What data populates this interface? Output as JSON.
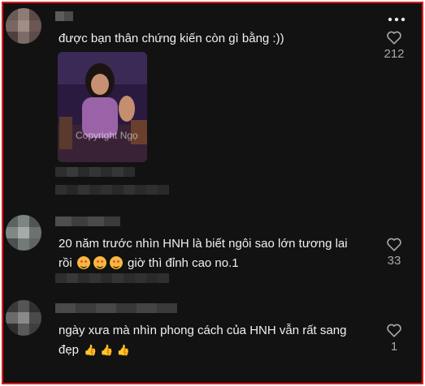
{
  "comments": [
    {
      "text": "được bạn thân chứng kiến còn gì bằng :))",
      "likes": "212",
      "photo_watermark": "Copyright Ngọ"
    },
    {
      "text_part1": "20 năm trước nhìn HNH là biết ngôi sao lớn tương lai",
      "text_part2_prefix": "rồi",
      "text_part2_suffix": "giờ thì đỉnh cao no.1",
      "emoji_count": 3,
      "likes": "33"
    },
    {
      "text_part1": "ngày xưa mà nhìn phong cách của HNH vẫn rất sang",
      "text_part2": "đẹp",
      "likes": "1"
    }
  ],
  "colors": {
    "background": "#121212",
    "text": "#f1f1f1",
    "muted": "#a8a8a8",
    "border": "#e11a1a"
  },
  "icons": [
    "more-options-icon",
    "heart-outline-icon",
    "star-struck-emoji",
    "thumbs-up-emoji"
  ]
}
